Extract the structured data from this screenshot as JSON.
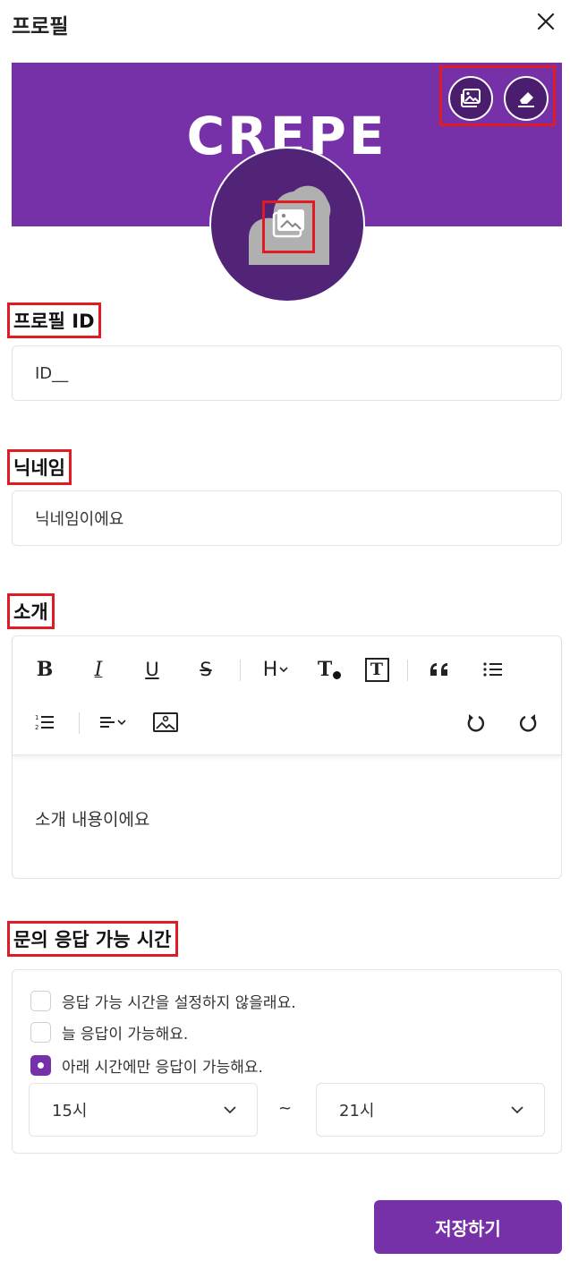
{
  "header": {
    "title": "프로필"
  },
  "banner": {
    "logo_text": "CREPE",
    "colors": {
      "background": "#7731a8",
      "avatar": "#522478",
      "button": "#4a1d6e"
    }
  },
  "fields": {
    "profile_id": {
      "label": "프로필 ID",
      "value": "ID__"
    },
    "nickname": {
      "label": "닉네임",
      "value": "닉네임이에요"
    },
    "intro": {
      "label": "소개",
      "content": "소개 내용이에요"
    }
  },
  "toolbar": {
    "bold": "B",
    "italic": "I",
    "underline": "U",
    "strike": "S",
    "heading": "H",
    "text_color": "T",
    "text_box": "T"
  },
  "response_hours": {
    "label": "문의 응답 가능 시간",
    "options": [
      {
        "label": "응답 가능 시간을 설정하지 않을래요.",
        "checked": false
      },
      {
        "label": "늘 응답이 가능해요.",
        "checked": false
      },
      {
        "label": "아래 시간에만 응답이 가능해요.",
        "checked": true
      }
    ],
    "start": "15시",
    "separator": "~",
    "end": "21시"
  },
  "save_label": "저장하기",
  "accent_color": "#7731a8"
}
